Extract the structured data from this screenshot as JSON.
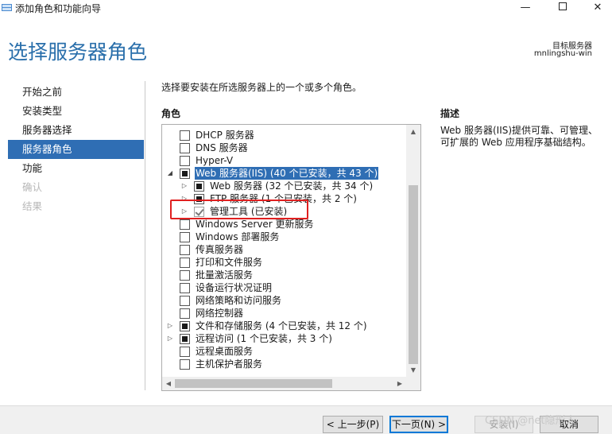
{
  "window": {
    "title": "添加角色和功能向导",
    "minimize_glyph": "—",
    "close_glyph": "✕"
  },
  "page": {
    "title": "选择服务器角色"
  },
  "target": {
    "label": "目标服务器",
    "server": "mnlingshu-win"
  },
  "nav": {
    "items": [
      {
        "label": "开始之前",
        "state": "normal"
      },
      {
        "label": "安装类型",
        "state": "normal"
      },
      {
        "label": "服务器选择",
        "state": "normal"
      },
      {
        "label": "服务器角色",
        "state": "selected"
      },
      {
        "label": "功能",
        "state": "normal"
      },
      {
        "label": "确认",
        "state": "disabled"
      },
      {
        "label": "结果",
        "state": "disabled"
      }
    ]
  },
  "instruction": "选择要安装在所选服务器上的一个或多个角色。",
  "roles": {
    "header": "角色",
    "items": [
      {
        "label": "DHCP 服务器",
        "indent": 0,
        "expander": "none",
        "check": "unchecked",
        "selected": false
      },
      {
        "label": "DNS 服务器",
        "indent": 0,
        "expander": "none",
        "check": "unchecked",
        "selected": false
      },
      {
        "label": "Hyper-V",
        "indent": 0,
        "expander": "none",
        "check": "unchecked",
        "selected": false
      },
      {
        "label": "Web 服务器(IIS) (40 个已安装，共 43 个)",
        "indent": 0,
        "expander": "expanded",
        "check": "partial",
        "selected": true
      },
      {
        "label": "Web 服务器 (32 个已安装，共 34 个)",
        "indent": 1,
        "expander": "collapsed",
        "check": "partial",
        "selected": false
      },
      {
        "label": "FTP 服务器 (1 个已安装，共 2 个)",
        "indent": 1,
        "expander": "collapsed",
        "check": "partial",
        "selected": false
      },
      {
        "label": "管理工具 (已安装)",
        "indent": 1,
        "expander": "collapsed",
        "check": "checked",
        "selected": false
      },
      {
        "label": "Windows Server 更新服务",
        "indent": 0,
        "expander": "none",
        "check": "unchecked",
        "selected": false
      },
      {
        "label": "Windows 部署服务",
        "indent": 0,
        "expander": "none",
        "check": "unchecked",
        "selected": false
      },
      {
        "label": "传真服务器",
        "indent": 0,
        "expander": "none",
        "check": "unchecked",
        "selected": false
      },
      {
        "label": "打印和文件服务",
        "indent": 0,
        "expander": "none",
        "check": "unchecked",
        "selected": false
      },
      {
        "label": "批量激活服务",
        "indent": 0,
        "expander": "none",
        "check": "unchecked",
        "selected": false
      },
      {
        "label": "设备运行状况证明",
        "indent": 0,
        "expander": "none",
        "check": "unchecked",
        "selected": false
      },
      {
        "label": "网络策略和访问服务",
        "indent": 0,
        "expander": "none",
        "check": "unchecked",
        "selected": false
      },
      {
        "label": "网络控制器",
        "indent": 0,
        "expander": "none",
        "check": "unchecked",
        "selected": false
      },
      {
        "label": "文件和存储服务 (4 个已安装，共 12 个)",
        "indent": 0,
        "expander": "collapsed",
        "check": "partial",
        "selected": false
      },
      {
        "label": "远程访问 (1 个已安装，共 3 个)",
        "indent": 0,
        "expander": "collapsed",
        "check": "partial",
        "selected": false
      },
      {
        "label": "远程桌面服务",
        "indent": 0,
        "expander": "none",
        "check": "unchecked",
        "selected": false
      },
      {
        "label": "主机保护者服务",
        "indent": 0,
        "expander": "none",
        "check": "unchecked",
        "selected": false
      }
    ]
  },
  "description": {
    "header": "描述",
    "text": "Web 服务器(IIS)提供可靠、可管理、可扩展的 Web 应用程序基础结构。"
  },
  "buttons": {
    "prev": "< 上一步(P)",
    "next": "下一页(N) >",
    "install": "安装(I)",
    "cancel": "取消"
  },
  "watermark": "CSDN @net隐形人",
  "colors": {
    "accent": "#2f6eb4",
    "title": "#2a6fab",
    "annotation": "#e02020"
  },
  "icons": {
    "expanded": "◢",
    "collapsed": "▷",
    "scroll_up": "▲",
    "scroll_down": "▼",
    "scroll_left": "◀",
    "scroll_right": "▶"
  }
}
